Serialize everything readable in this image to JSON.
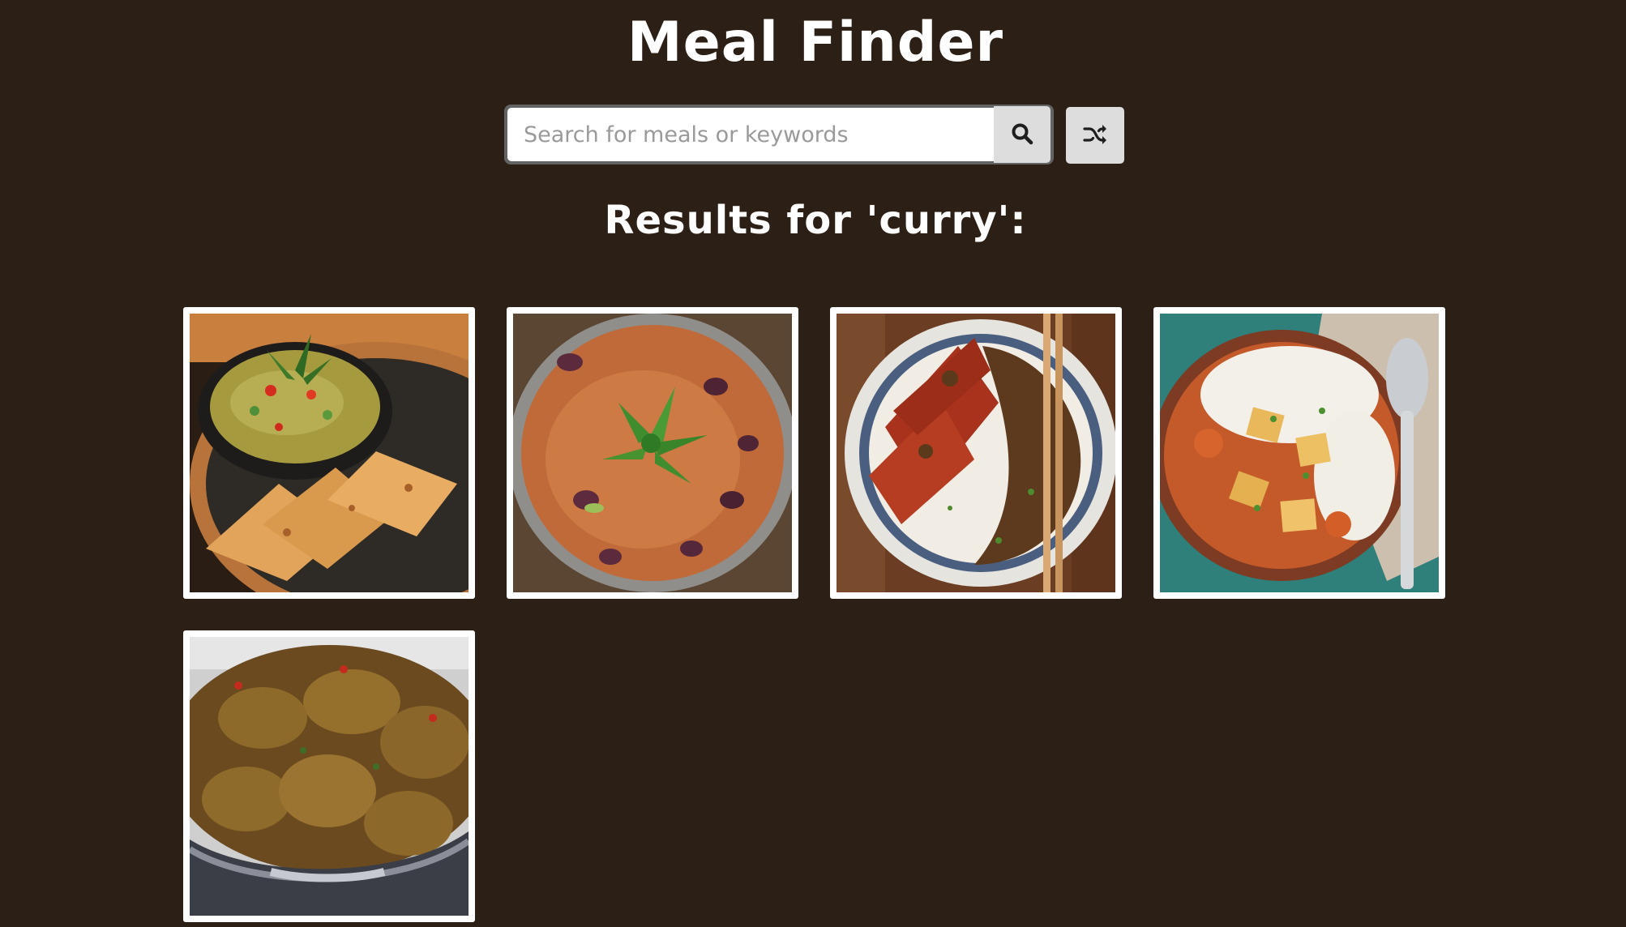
{
  "app": {
    "title": "Meal Finder"
  },
  "search": {
    "placeholder": "Search for meals or keywords",
    "value": "",
    "submit_icon": "search-icon",
    "random_icon": "shuffle-icon"
  },
  "results": {
    "heading": "Results for 'curry':",
    "meals": [
      {
        "image": "green-curry-with-flatbread"
      },
      {
        "image": "kidney-bean-curry"
      },
      {
        "image": "katsu-chicken-curry"
      },
      {
        "image": "chicken-curry-with-rice"
      },
      {
        "image": "chicken-curry-in-pan"
      }
    ]
  },
  "colors": {
    "background": "#2c1f15",
    "button": "#dddddd",
    "text": "#ffffff"
  }
}
